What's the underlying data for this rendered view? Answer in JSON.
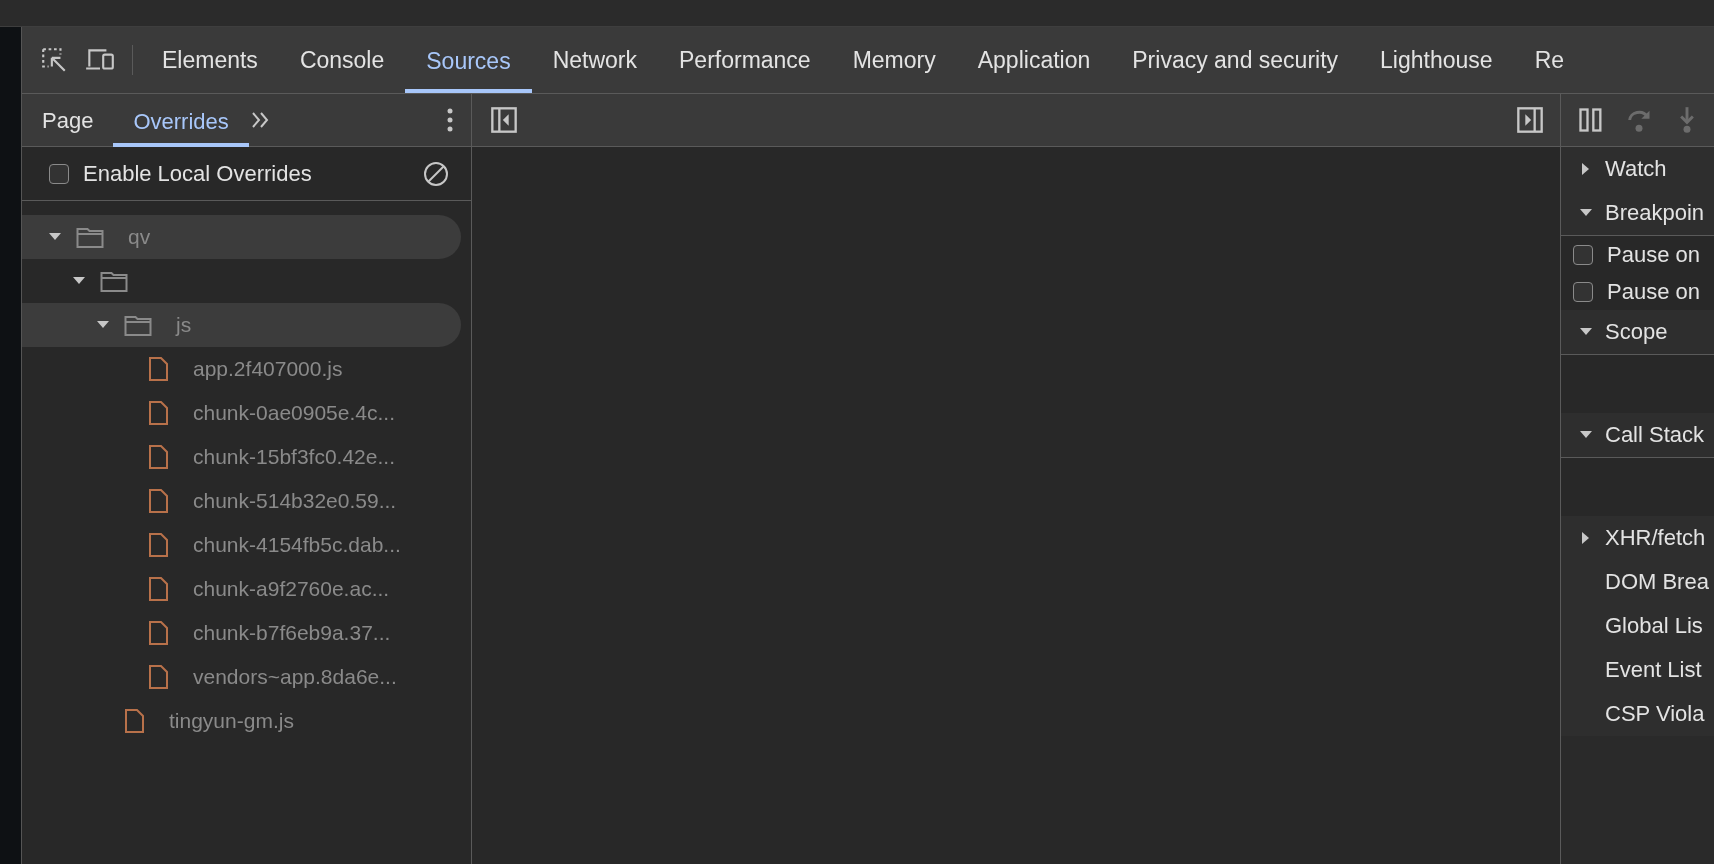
{
  "main_tabs": [
    {
      "label": "Elements",
      "selected": false
    },
    {
      "label": "Console",
      "selected": false
    },
    {
      "label": "Sources",
      "selected": true
    },
    {
      "label": "Network",
      "selected": false
    },
    {
      "label": "Performance",
      "selected": false
    },
    {
      "label": "Memory",
      "selected": false
    },
    {
      "label": "Application",
      "selected": false
    },
    {
      "label": "Privacy and security",
      "selected": false
    },
    {
      "label": "Lighthouse",
      "selected": false
    },
    {
      "label": "Re",
      "selected": false
    }
  ],
  "navigator_tabs": [
    {
      "label": "Page",
      "selected": false
    },
    {
      "label": "Overrides",
      "selected": true
    }
  ],
  "overrides": {
    "label": "Enable Local Overrides",
    "checked": false
  },
  "file_tree": [
    {
      "kind": "folder",
      "name": "qv",
      "expanded": true,
      "highlighted": true,
      "children": [
        {
          "kind": "folder",
          "expanded": true,
          "highlighted": false,
          "children": [
            {
              "kind": "folder",
              "name": "js",
              "expanded": true,
              "highlighted": true,
              "children": [
                {
                  "kind": "file",
                  "name": "app.2f407000.js"
                },
                {
                  "kind": "file",
                  "name": "chunk-0ae0905e.4c..."
                },
                {
                  "kind": "file",
                  "name": "chunk-15bf3fc0.42e..."
                },
                {
                  "kind": "file",
                  "name": "chunk-514b32e0.59..."
                },
                {
                  "kind": "file",
                  "name": "chunk-4154fb5c.dab..."
                },
                {
                  "kind": "file",
                  "name": "chunk-a9f2760e.ac..."
                },
                {
                  "kind": "file",
                  "name": "chunk-b7f6eb9a.37..."
                },
                {
                  "kind": "file",
                  "name": "vendors~app.8da6e..."
                }
              ]
            },
            {
              "kind": "file",
              "name": "tingyun-gm.js"
            }
          ]
        }
      ]
    }
  ],
  "debugger_pane": [
    {
      "kind": "section",
      "label": "Watch",
      "expanded": false
    },
    {
      "kind": "section",
      "label": "Breakpoin",
      "expanded": true
    },
    {
      "kind": "checkbox",
      "label": "Pause on",
      "checked": false
    },
    {
      "kind": "checkbox",
      "label": "Pause on",
      "checked": false
    },
    {
      "kind": "section",
      "label": "Scope",
      "expanded": true
    },
    {
      "kind": "gap"
    },
    {
      "kind": "section",
      "label": "Call Stack",
      "expanded": true
    },
    {
      "kind": "gap"
    },
    {
      "kind": "section",
      "label": "XHR/fetch",
      "expanded": false
    },
    {
      "kind": "section",
      "label": "DOM Brea"
    },
    {
      "kind": "section",
      "label": "Global Lis"
    },
    {
      "kind": "section",
      "label": "Event List"
    },
    {
      "kind": "section",
      "label": "CSP Viola"
    }
  ]
}
